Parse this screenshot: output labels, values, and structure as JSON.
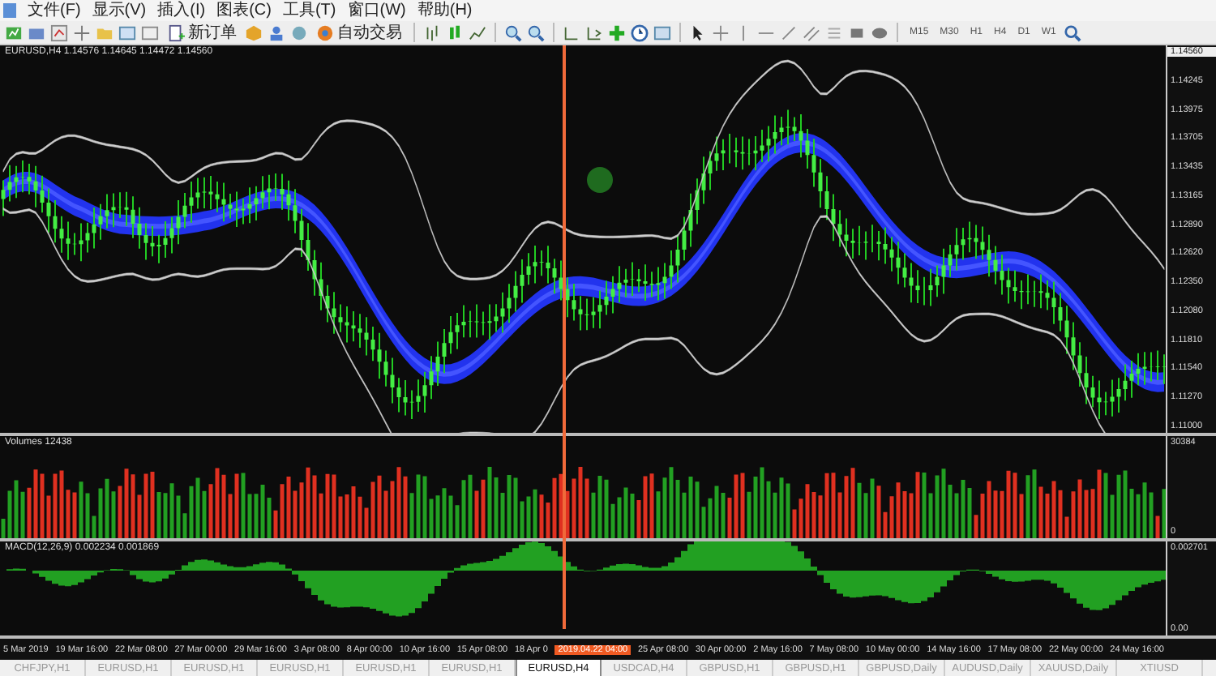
{
  "menu": [
    "文件(F)",
    "显示(V)",
    "插入(I)",
    "图表(C)",
    "工具(T)",
    "窗口(W)",
    "帮助(H)"
  ],
  "toolbar": {
    "new_order": "新订单",
    "auto_trading": "自动交易",
    "timeframes": [
      "M15",
      "M30",
      "H1",
      "H4",
      "D1",
      "W1"
    ]
  },
  "chart": {
    "title": "EURUSD,H4  1.14576 1.14645 1.14472 1.14560",
    "price_axis": [
      {
        "label": "1.14560",
        "kind": "current"
      },
      {
        "label": "1.14245",
        "kind": "tick"
      },
      {
        "label": "1.13975",
        "kind": "tick"
      },
      {
        "label": "1.13705",
        "kind": "tick"
      },
      {
        "label": "1.13435",
        "kind": "tick"
      },
      {
        "label": "1.13165",
        "kind": "tick"
      },
      {
        "label": "1.12890",
        "kind": "tick"
      },
      {
        "label": "1.12620",
        "kind": "tick"
      },
      {
        "label": "1.12350",
        "kind": "tick"
      },
      {
        "label": "1.12080",
        "kind": "tick"
      },
      {
        "label": "1.11810",
        "kind": "tick"
      },
      {
        "label": "1.11540",
        "kind": "tick"
      },
      {
        "label": "1.11270",
        "kind": "tick"
      },
      {
        "label": "1.11000",
        "kind": "tick"
      }
    ],
    "volumes": {
      "title": "Volumes 12438",
      "axis": [
        "30384",
        "0"
      ]
    },
    "macd": {
      "title": "MACD(12,26,9) 0.002234 0.001869",
      "axis": [
        "0.002701",
        "0.00"
      ]
    },
    "time_axis": [
      {
        "label": "5 Mar 2019",
        "kind": "tick"
      },
      {
        "label": "19 Mar 16:00",
        "kind": "tick"
      },
      {
        "label": "22 Mar 08:00",
        "kind": "tick"
      },
      {
        "label": "27 Mar 00:00",
        "kind": "tick"
      },
      {
        "label": "29 Mar 16:00",
        "kind": "tick"
      },
      {
        "label": "3 Apr 08:00",
        "kind": "tick"
      },
      {
        "label": "8 Apr 00:00",
        "kind": "tick"
      },
      {
        "label": "10 Apr 16:00",
        "kind": "tick"
      },
      {
        "label": "15 Apr 08:00",
        "kind": "tick"
      },
      {
        "label": "18 Apr 0",
        "kind": "tick"
      },
      {
        "label": "2019.04.22 04:00",
        "kind": "crosshair"
      },
      {
        "label": "25 Apr 08:00",
        "kind": "tick"
      },
      {
        "label": "30 Apr 00:00",
        "kind": "tick"
      },
      {
        "label": "2 May 16:00",
        "kind": "tick"
      },
      {
        "label": "7 May 08:00",
        "kind": "tick"
      },
      {
        "label": "10 May 00:00",
        "kind": "tick"
      },
      {
        "label": "14 May 16:00",
        "kind": "tick"
      },
      {
        "label": "17 May 08:00",
        "kind": "tick"
      },
      {
        "label": "22 May 00:00",
        "kind": "tick"
      },
      {
        "label": "24 May 16:00",
        "kind": "tick"
      }
    ]
  },
  "tabs": [
    {
      "label": "CHFJPY,H1",
      "selected": false
    },
    {
      "label": "EURUSD,H1",
      "selected": false
    },
    {
      "label": "EURUSD,H1",
      "selected": false
    },
    {
      "label": "EURUSD,H1",
      "selected": false
    },
    {
      "label": "EURUSD,H1",
      "selected": false
    },
    {
      "label": "EURUSD,H1",
      "selected": false
    },
    {
      "label": "EURUSD,H4",
      "selected": true
    },
    {
      "label": "USDCAD,H4",
      "selected": false
    },
    {
      "label": "GBPUSD,H1",
      "selected": false
    },
    {
      "label": "GBPUSD,H1",
      "selected": false
    },
    {
      "label": "GBPUSD,Daily",
      "selected": false
    },
    {
      "label": "AUDUSD,Daily",
      "selected": false
    },
    {
      "label": "XAUUSD,Daily",
      "selected": false
    },
    {
      "label": "XTIUSD",
      "selected": false
    }
  ]
}
